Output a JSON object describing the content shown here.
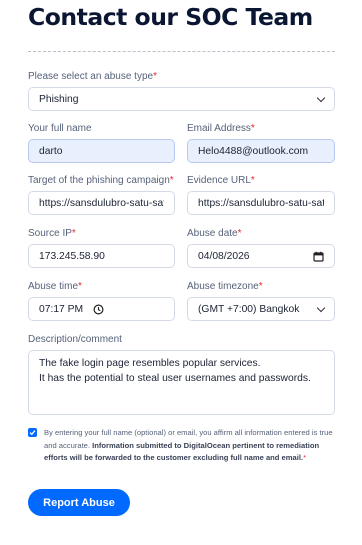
{
  "page": {
    "title": "Contact our SOC Team"
  },
  "form": {
    "abuse_type": {
      "label": "Please select an abuse type",
      "required_mark": "*",
      "value": "Phishing"
    },
    "full_name": {
      "label": "Your full name",
      "value": "darto"
    },
    "email": {
      "label": "Email Address",
      "required_mark": "*",
      "value": "Helo4488@outlook.com"
    },
    "target": {
      "label": "Target of the phishing campaign",
      "required_mark": "*",
      "value": "https://sansdulubro-satu-satu"
    },
    "evidence_url": {
      "label": "Evidence URL",
      "required_mark": "*",
      "value": "https://sansdulubro-satu-satu"
    },
    "source_ip": {
      "label": "Source IP",
      "required_mark": "*",
      "value": "173.245.58.90"
    },
    "abuse_date": {
      "label": "Abuse date",
      "required_mark": "*",
      "value": "04/08/2026"
    },
    "abuse_time": {
      "label": "Abuse time",
      "required_mark": "*",
      "value": "07:17 PM"
    },
    "abuse_timezone": {
      "label": "Abuse timezone",
      "required_mark": "*",
      "value": "(GMT +7:00) Bangkok"
    },
    "description": {
      "label": "Description/comment",
      "lines": [
        "The fake login page resembles popular services.",
        "It has the potential to steal user usernames and passwords."
      ]
    },
    "consent": {
      "checked": true,
      "text_plain": "By entering your full name (optional) or email, you affirm all information entered is true and accurate.",
      "text_bold": "Information submitted to DigitalOcean pertinent to remediation efforts will be forwarded to the customer excluding full name and email.",
      "required_mark": "*"
    },
    "submit_label": "Report Abuse"
  },
  "colors": {
    "accent": "#0069ff",
    "required": "#e5292f",
    "autofill_bg": "#e8f0fe",
    "heading": "#0b1633"
  }
}
